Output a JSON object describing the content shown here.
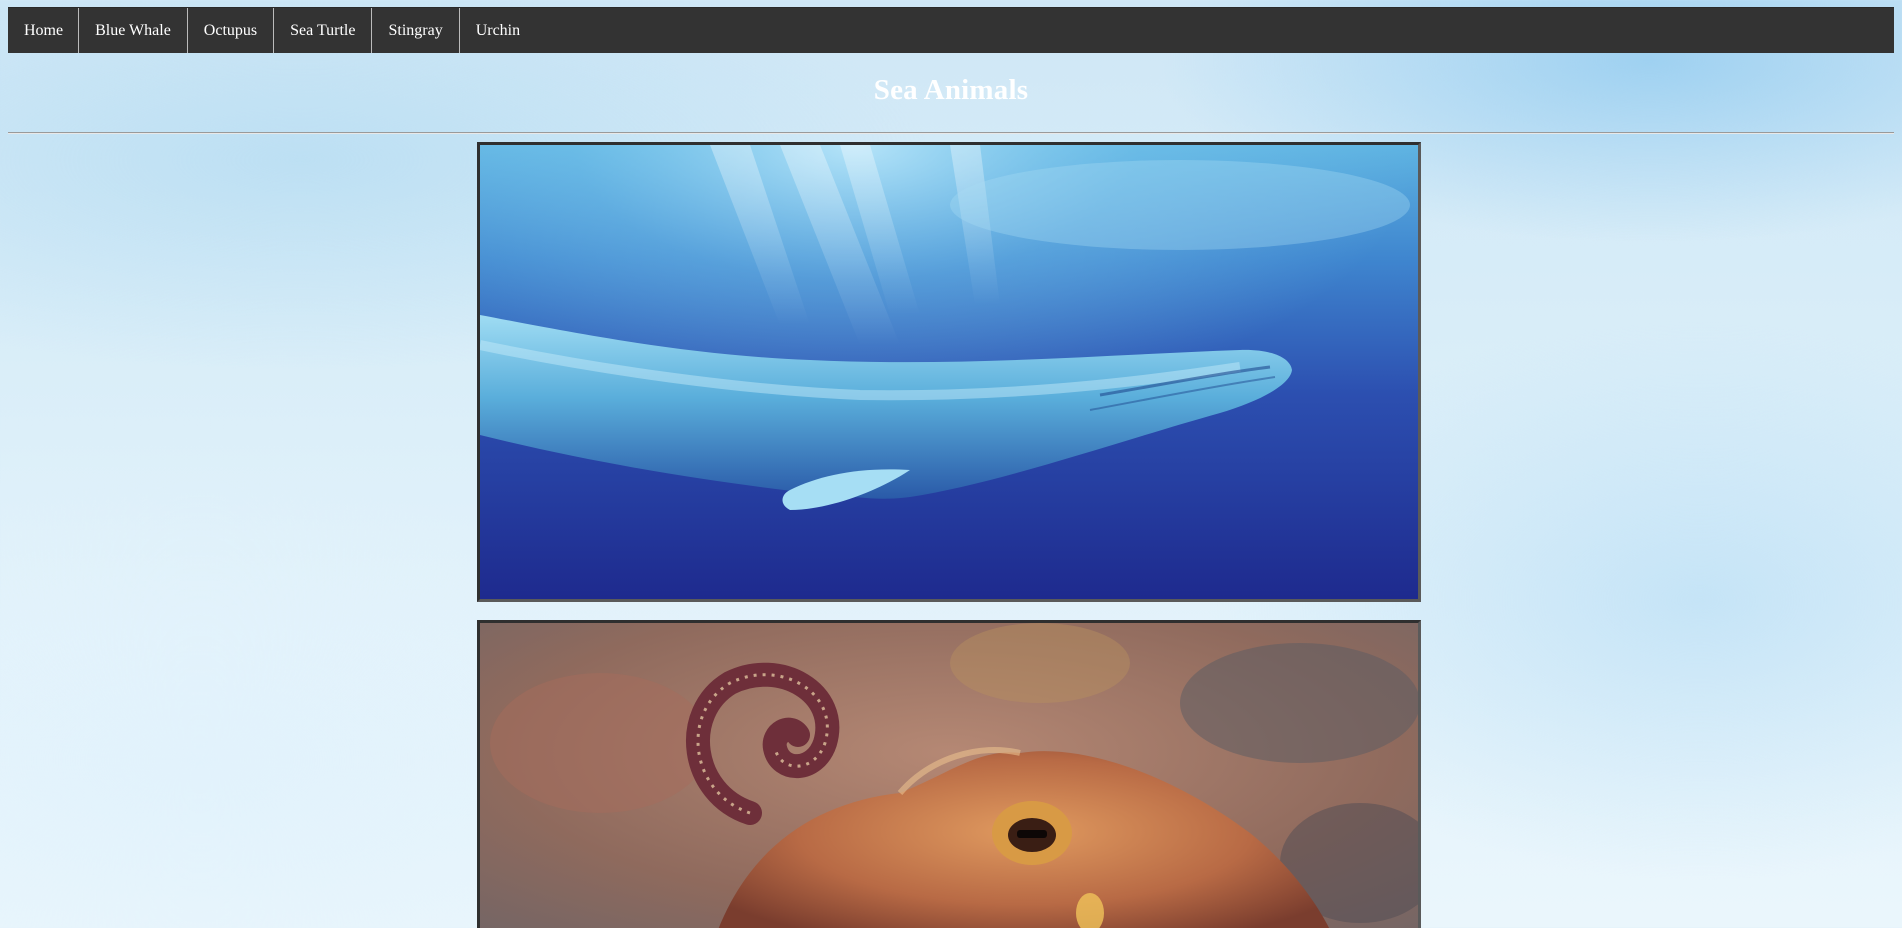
{
  "nav": {
    "items": [
      {
        "label": "Home"
      },
      {
        "label": "Blue Whale"
      },
      {
        "label": "Octupus"
      },
      {
        "label": "Sea Turtle"
      },
      {
        "label": "Stingray"
      },
      {
        "label": "Urchin"
      }
    ]
  },
  "page": {
    "title": "Sea Animals"
  },
  "gallery": {
    "images": [
      {
        "subject": "blue-whale-photo"
      },
      {
        "subject": "octopus-photo"
      }
    ]
  },
  "colors": {
    "navbar": "#333333",
    "nav_text": "#ffffff",
    "title_text": "#ffffff",
    "frame_border": "#2f2f2f"
  }
}
